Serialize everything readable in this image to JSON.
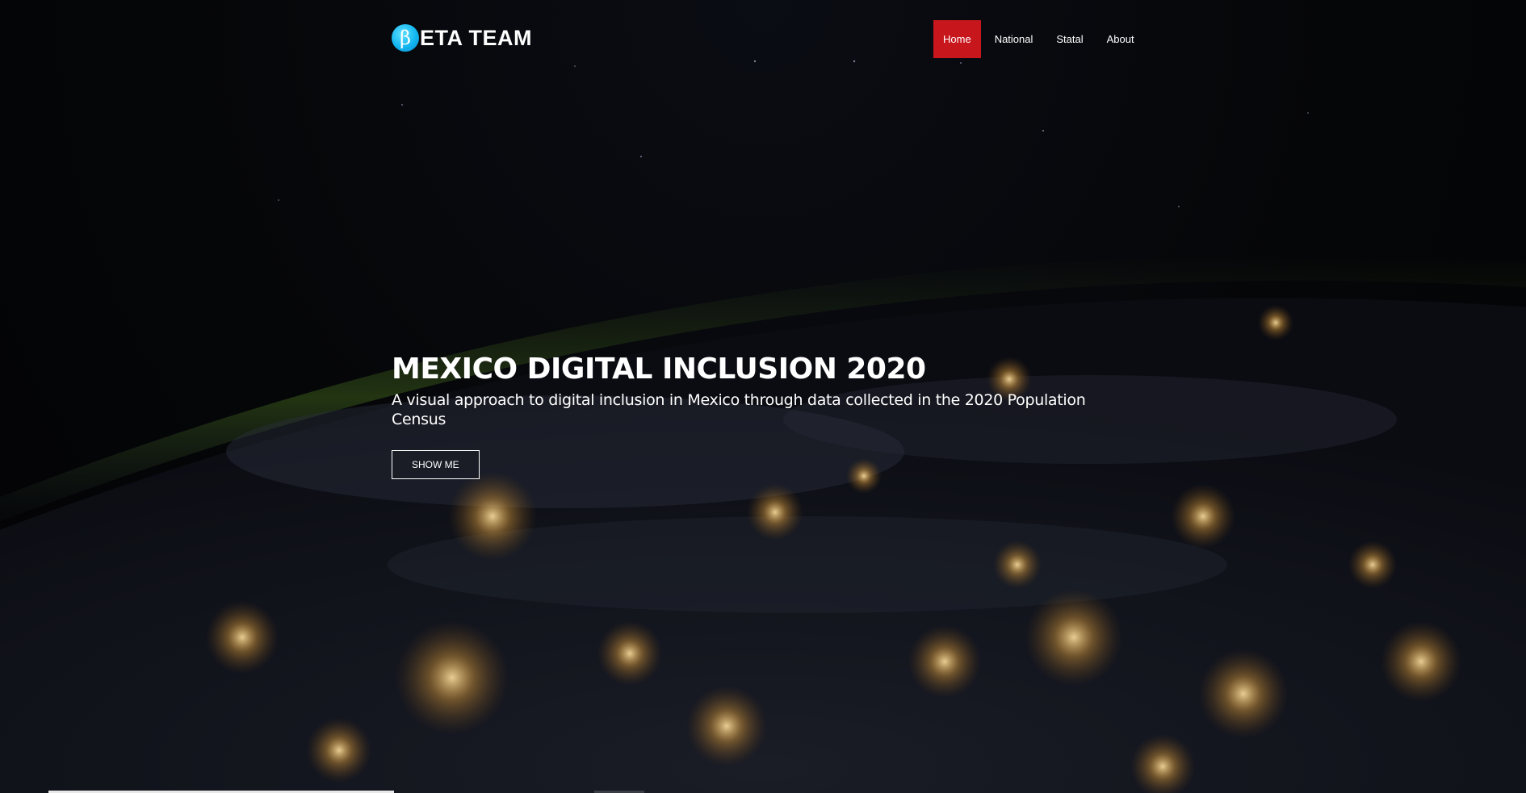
{
  "brand": {
    "logo_glyph": "β",
    "name": "ETA TEAM",
    "logo_color": "#19b8f2"
  },
  "nav": {
    "items": [
      {
        "label": "Home",
        "active": true
      },
      {
        "label": "National",
        "active": false
      },
      {
        "label": "Statal",
        "active": false
      },
      {
        "label": "About",
        "active": false
      }
    ],
    "active_color": "#c8161d"
  },
  "hero": {
    "title": "MEXICO DIGITAL INCLUSION 2020",
    "subtitle": "A visual approach to digital inclusion in Mexico through data collected in the 2020 Population Census",
    "button_label": "SHOW ME",
    "background": "earth-at-night-from-space"
  }
}
